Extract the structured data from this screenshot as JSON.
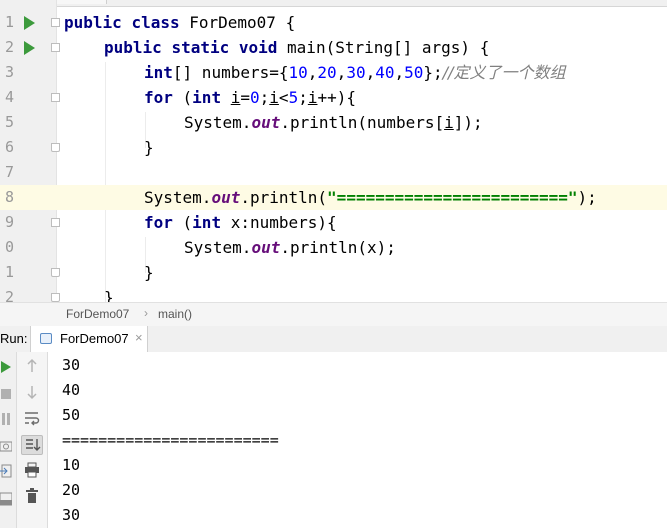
{
  "editor": {
    "line_numbers": [
      "1",
      "2",
      "3",
      "4",
      "5",
      "6",
      "7",
      "8",
      "9",
      "0",
      "1",
      "2"
    ],
    "line1": {
      "kw1": "public",
      "kw2": "class",
      "rest": " ForDemo07 {"
    },
    "line2": {
      "kw1": "public",
      "kw2": "static",
      "kw3": "void",
      "rest": " main(String[] args) {"
    },
    "line3": {
      "kw": "int",
      "a": "[] numbers={",
      "n1": "10",
      "n2": "20",
      "n3": "30",
      "n4": "40",
      "n5": "50",
      "b": "};",
      "comment": "//定义了一个数组"
    },
    "line4": {
      "kw1": "for",
      "a": " (",
      "kw2": "int",
      "v1": "i",
      "b": "=",
      "n1": "0",
      "c": ";",
      "v2": "i",
      "d": "<",
      "n2": "5",
      "e": ";",
      "v3": "i",
      "f": "++){"
    },
    "line5": {
      "a": "System.",
      "field": "out",
      "b": ".println(numbers[",
      "v": "i",
      "c": "]);"
    },
    "line6": {
      "text": "}"
    },
    "line8": {
      "a": "System.",
      "field": "out",
      "b": ".println(",
      "str": "\"========================\"",
      "c": ");"
    },
    "line9": {
      "kw1": "for",
      "a": " (",
      "kw2": "int",
      "b": " x:numbers){"
    },
    "line10": {
      "a": "System.",
      "field": "out",
      "b": ".println(x);"
    },
    "line11": {
      "text": "}"
    },
    "line12": {
      "text": "}"
    }
  },
  "breadcrumb": {
    "class": "ForDemo07",
    "separator": "›",
    "method": "main()"
  },
  "run": {
    "label": "Run:",
    "tab_title": "ForDemo07",
    "close": "×"
  },
  "toolbar_icons": [
    "run-icon",
    "stop-icon",
    "pause-icon",
    "camera-icon",
    "login-icon",
    "layout-icon",
    "up-arrow-icon",
    "down-arrow-icon",
    "soft-wrap-icon",
    "scroll-to-end-icon",
    "print-icon",
    "trash-icon"
  ],
  "console": {
    "lines": [
      "30",
      "40",
      "50",
      "========================",
      "10",
      "20",
      "30"
    ]
  },
  "colors": {
    "keyword": "#000080",
    "number": "#0000ff",
    "string": "#008000",
    "comment": "#808080",
    "field": "#660e7a",
    "caret_line": "#fefbe4",
    "run_green": "#3c9a3c"
  }
}
